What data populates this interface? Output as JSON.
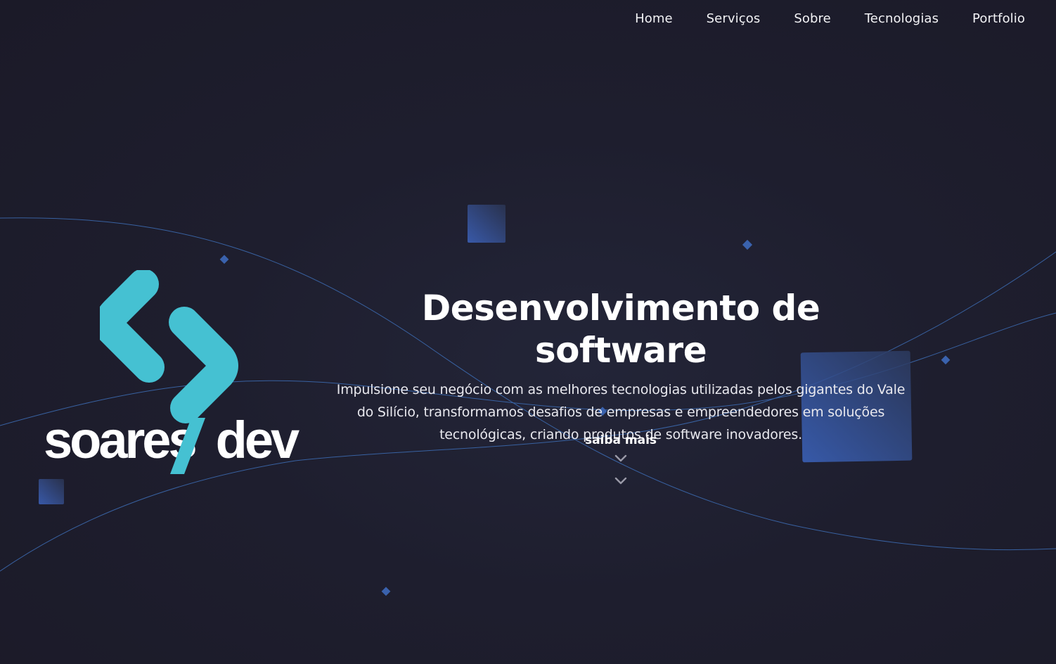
{
  "nav": {
    "items": [
      {
        "label": "Home"
      },
      {
        "label": "Serviços"
      },
      {
        "label": "Sobre"
      },
      {
        "label": "Tecnologias"
      },
      {
        "label": "Portfolio"
      }
    ]
  },
  "logo": {
    "text_left": "soares",
    "text_right": "dev"
  },
  "hero": {
    "title": "Desenvolvimento de software",
    "description": "Impulsione seu negócio com as melhores tecnologias utilizadas pelos gigantes do Vale do Silício, transformamos desafios de empresas e empreendedores em soluções tecnológicas, criando produtos de software inovadores.",
    "more_label": "saiba mais"
  },
  "colors": {
    "background": "#1d1c2b",
    "accent": "#45c1d2",
    "lines": "#3f6fb8",
    "cube": "#3a64b0"
  },
  "icons": [
    "chevron-down-icon",
    "chevron-down-icon"
  ]
}
